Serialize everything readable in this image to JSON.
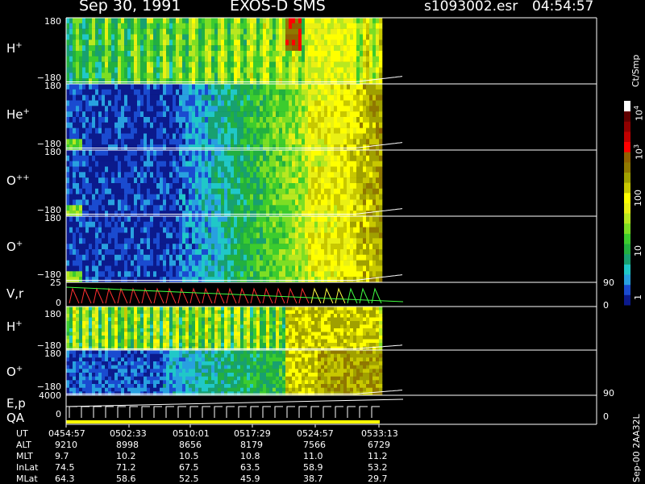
{
  "header": {
    "date": "Sep 30, 1991",
    "instrument": "EXOS-D SMS",
    "file": "s1093002.esr",
    "time": "04:54:57"
  },
  "colorbar": {
    "unit": "Ct/Smp",
    "ticks": [
      "1",
      "10",
      "100",
      "10",
      "10"
    ],
    "tick_exponents": [
      "",
      "",
      "",
      "3",
      "4"
    ],
    "colors": [
      "#0b1a8c",
      "#1a4bd0",
      "#28a0e0",
      "#20c8c8",
      "#18a070",
      "#22b040",
      "#3ccc2e",
      "#7cde24",
      "#b8e820",
      "#eaf014",
      "#ffff00",
      "#c8c800",
      "#a0a000",
      "#907800",
      "#906000",
      "#ff0000",
      "#c00000",
      "#900000",
      "#600000",
      "#ffffff"
    ]
  },
  "version_tag": "Sep-00  2AA32L",
  "panels": [
    {
      "label": "H",
      "sup": "+",
      "ytop": "180",
      "ybot": "−180"
    },
    {
      "label": "He",
      "sup": "+",
      "ytop": "180",
      "ybot": "−180"
    },
    {
      "label": "O",
      "sup": "++",
      "ytop": "180",
      "ybot": "−180"
    },
    {
      "label": "O",
      "sup": "+",
      "ytop": "180",
      "ybot": "−180"
    },
    {
      "label": "V,r",
      "sup": "",
      "ytop": "25",
      "ybot": "0",
      "rtop": "90",
      "rbot": "0"
    },
    {
      "label": "H",
      "sup": "+",
      "ytop": "180",
      "ybot": "−180"
    },
    {
      "label": "O",
      "sup": "+",
      "ytop": "180",
      "ybot": "−180"
    },
    {
      "label": "E,p",
      "sup": "",
      "label2": "QA",
      "ytop": "4000",
      "ybot": "0",
      "rtop": "90",
      "rbot": "0"
    }
  ],
  "orbit_table": {
    "row_labels": [
      "UT",
      "ALT",
      "MLT",
      "InLat",
      "MLat"
    ],
    "columns": [
      [
        "0454:57",
        "9210",
        "9.7",
        "74.5",
        "64.3"
      ],
      [
        "0502:33",
        "8998",
        "10.2",
        "71.2",
        "58.6"
      ],
      [
        "0510:01",
        "8656",
        "10.5",
        "67.5",
        "52.5"
      ],
      [
        "0517:29",
        "8179",
        "10.8",
        "63.5",
        "45.9"
      ],
      [
        "0524:57",
        "7566",
        "11.0",
        "58.9",
        "38.7"
      ],
      [
        "0533:13",
        "6729",
        "11.2",
        "53.2",
        "29.7"
      ]
    ]
  },
  "chart_data": {
    "type": "heatmap",
    "title": "Sep 30, 1991   EXOS-D SMS",
    "x": [
      "0454:57",
      "0502:33",
      "0510:01",
      "0517:29",
      "0524:57",
      "0533:13"
    ],
    "panel_ylims": [
      [
        -180,
        180
      ],
      [
        -180,
        180
      ],
      [
        -180,
        180
      ],
      [
        -180,
        180
      ],
      [
        0,
        25
      ],
      [
        -180,
        180
      ],
      [
        -180,
        180
      ],
      [
        0,
        4000
      ]
    ],
    "colorbar_scale": "log",
    "colorbar_range": [
      1,
      10000
    ],
    "data_coverage": "0454:57 to ~0530",
    "grid": false
  }
}
